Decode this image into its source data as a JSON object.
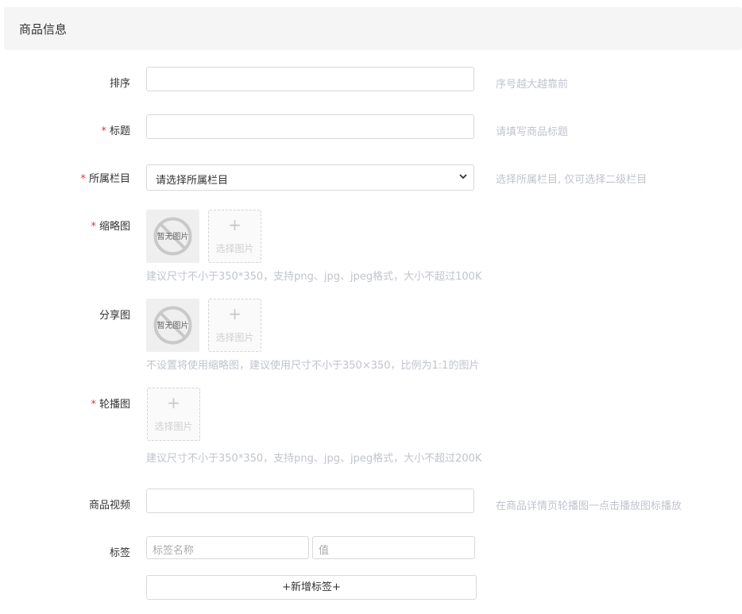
{
  "header": {
    "title": "商品信息"
  },
  "form": {
    "sort": {
      "label": "排序",
      "help": "序号越大越靠前"
    },
    "title": {
      "required_mark": "*",
      "label": "标题",
      "help": "请填写商品标题"
    },
    "category": {
      "required_mark": "*",
      "label": "所属栏目",
      "selected": "请选择所属栏目",
      "help": "选择所属栏目, 仅可选择二级栏目"
    },
    "thumbnail": {
      "required_mark": "*",
      "label": "缩略图",
      "placeholder_text": "暂无图片",
      "picker_plus": "+",
      "picker_label": "选择图片",
      "hint": "建议尺寸不小于350*350，支持png、jpg、jpeg格式，大小不超过100K"
    },
    "share_image": {
      "label": "分享图",
      "placeholder_text": "暂无图片",
      "picker_plus": "+",
      "picker_label": "选择图片",
      "hint": "不设置将使用缩略图，建议使用尺寸不小于350×350，比例为1:1的图片"
    },
    "carousel": {
      "required_mark": "*",
      "label": "轮播图",
      "picker_plus": "+",
      "picker_label": "选择图片",
      "hint": "建议尺寸不小于350*350，支持png、jpg、jpeg格式，大小不超过200K"
    },
    "video": {
      "label": "商品视频",
      "help": "在商品详情页轮播图一点击播放图标播放"
    },
    "tags": {
      "label": "标签",
      "name_placeholder": "标签名称",
      "value_placeholder": "值",
      "add_button": "+新增标签+"
    }
  },
  "colors": {
    "required": "#ee3333",
    "help_text": "#c0c4cc",
    "border": "#d9d9d9"
  },
  "icons": {
    "no_image": "no-image-icon",
    "dropdown": "chevron-down-icon"
  }
}
